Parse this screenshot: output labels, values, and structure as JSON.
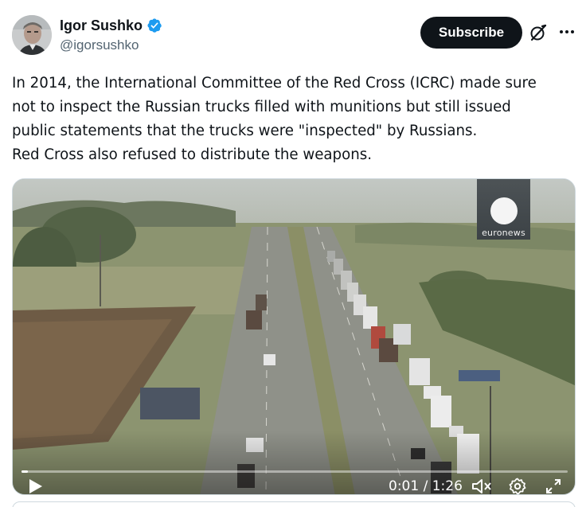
{
  "author": {
    "display_name": "Igor Sushko",
    "handle": "@igorsushko",
    "verified": true,
    "verified_color": "#1d9bf0"
  },
  "actions": {
    "subscribe_label": "Subscribe",
    "grok_icon": "grok-slash-icon",
    "more_icon": "more-dots-icon"
  },
  "tweet": {
    "lines": [
      "In 2014, the International Committee of the Red Cross (ICRC) made sure",
      "not to inspect the Russian trucks filled with munitions but still issued",
      "public statements that the trucks were \"inspected\" by Russians.",
      "Red Cross also refused to distribute the weapons."
    ]
  },
  "video": {
    "watermark": "euronews",
    "current_time": "0:01",
    "duration": "1:26",
    "time_display": "0:01 / 1:26",
    "progress_fraction": 0.012,
    "muted": true,
    "controls": [
      "play-icon",
      "mute-icon",
      "settings-gear-icon",
      "fullscreen-icon"
    ]
  },
  "colors": {
    "text": "#0f1419",
    "secondary_text": "#536471",
    "button_dark": "#0f1419",
    "border": "#cfd9de"
  }
}
